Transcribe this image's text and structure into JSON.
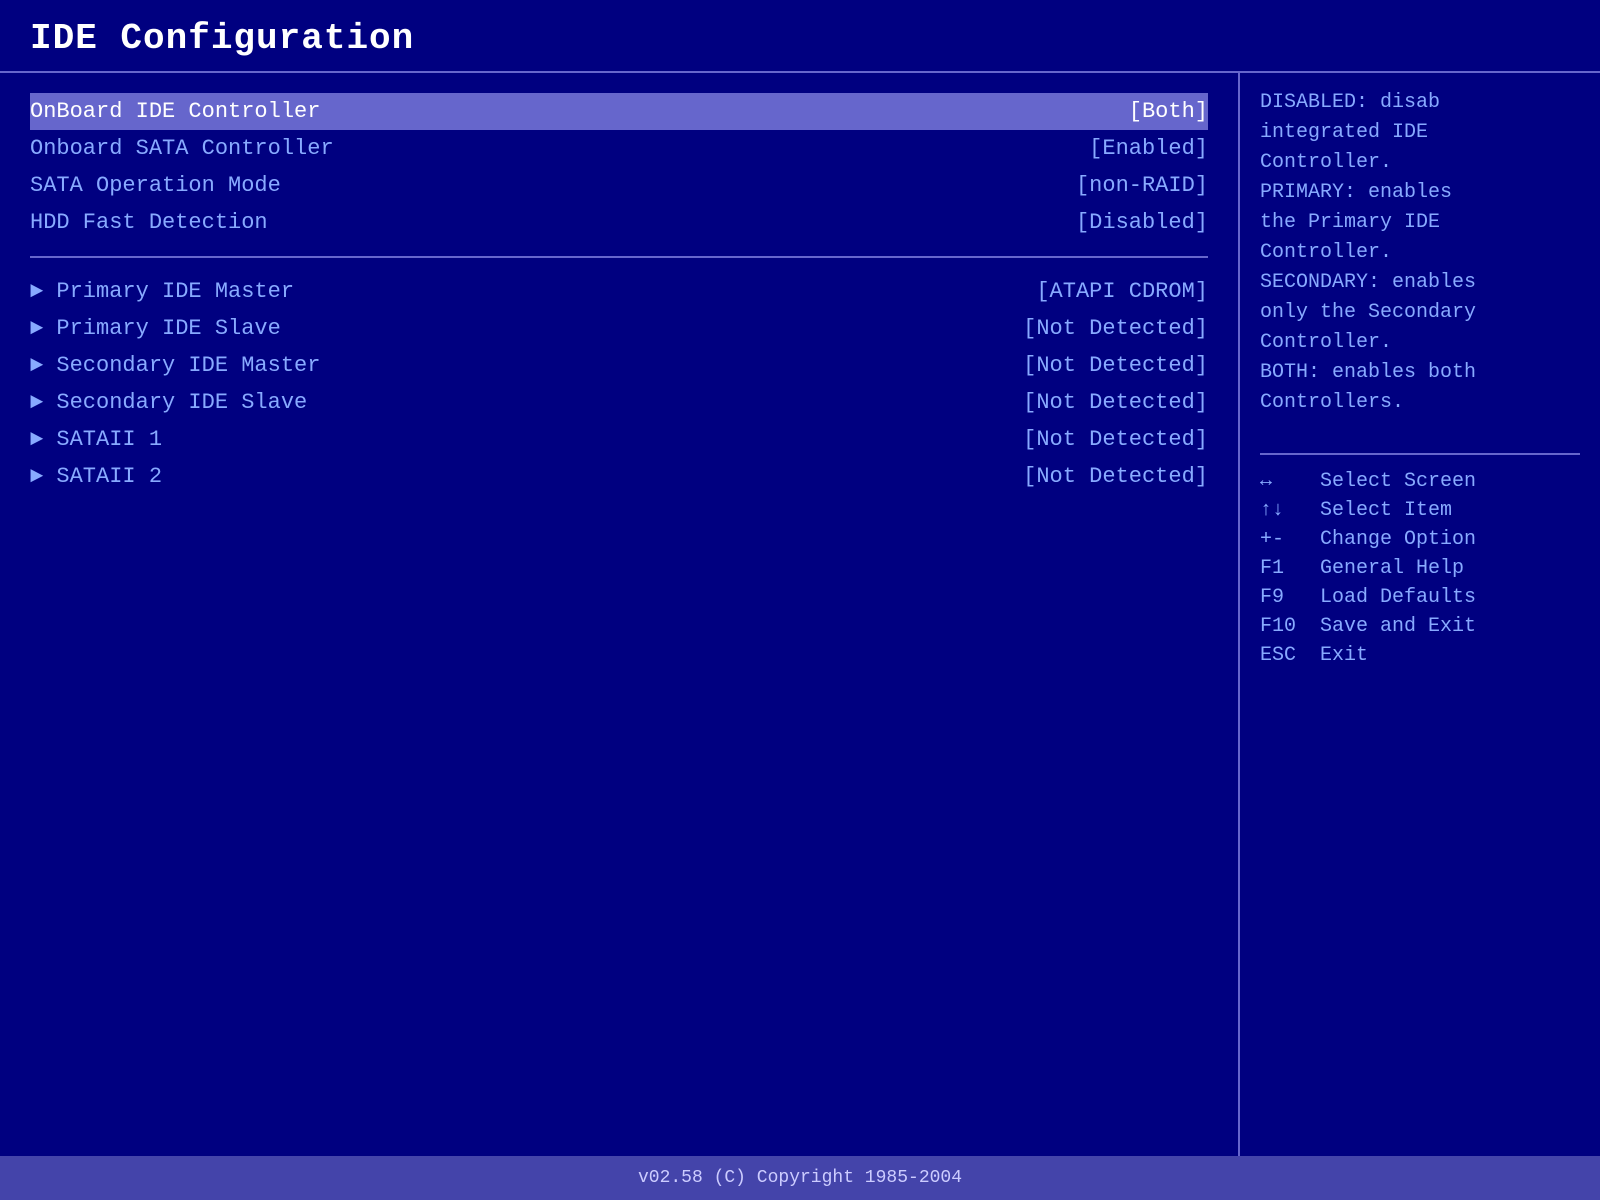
{
  "title": "IDE Configuration",
  "settings": [
    {
      "name": "OnBoard IDE Controller",
      "value": "[Both]",
      "highlighted": true
    },
    {
      "name": "Onboard SATA Controller",
      "value": "[Enabled]",
      "highlighted": false
    },
    {
      "name": "  SATA Operation Mode",
      "value": "[non-RAID]",
      "highlighted": false
    },
    {
      "name": "HDD Fast Detection",
      "value": "[Disabled]",
      "highlighted": false
    }
  ],
  "submenus": [
    {
      "name": "Primary IDE Master",
      "value": "[ATAPI CDROM]"
    },
    {
      "name": "Primary IDE Slave",
      "value": "[Not Detected]"
    },
    {
      "name": "Secondary IDE Master",
      "value": "[Not Detected]"
    },
    {
      "name": "Secondary IDE Slave",
      "value": "[Not Detected]"
    },
    {
      "name": "SATAII 1",
      "value": "[Not Detected]"
    },
    {
      "name": "SATAII 2",
      "value": "[Not Detected]"
    }
  ],
  "help": {
    "lines": [
      "DISABLED: disab",
      "integrated IDE",
      "Controller.",
      "PRIMARY: enables",
      "the Primary IDE",
      "Controller.",
      "SECONDARY: enables",
      "only the Secondary",
      "Controller.",
      "BOTH: enables both",
      "Controllers."
    ]
  },
  "keys": [
    {
      "symbol": "↔",
      "desc": "Select Screen"
    },
    {
      "symbol": "↑↓",
      "desc": "Select Item"
    },
    {
      "symbol": "+-",
      "desc": "Change Option"
    },
    {
      "symbol": "F1",
      "desc": "General Help"
    },
    {
      "symbol": "F9",
      "desc": "Load Defaults"
    },
    {
      "symbol": "F10",
      "desc": "Save and Exit"
    },
    {
      "symbol": "ESC",
      "desc": "Exit"
    }
  ],
  "footer": {
    "text": "v02.58  (C) Copyright 1985-2004"
  }
}
